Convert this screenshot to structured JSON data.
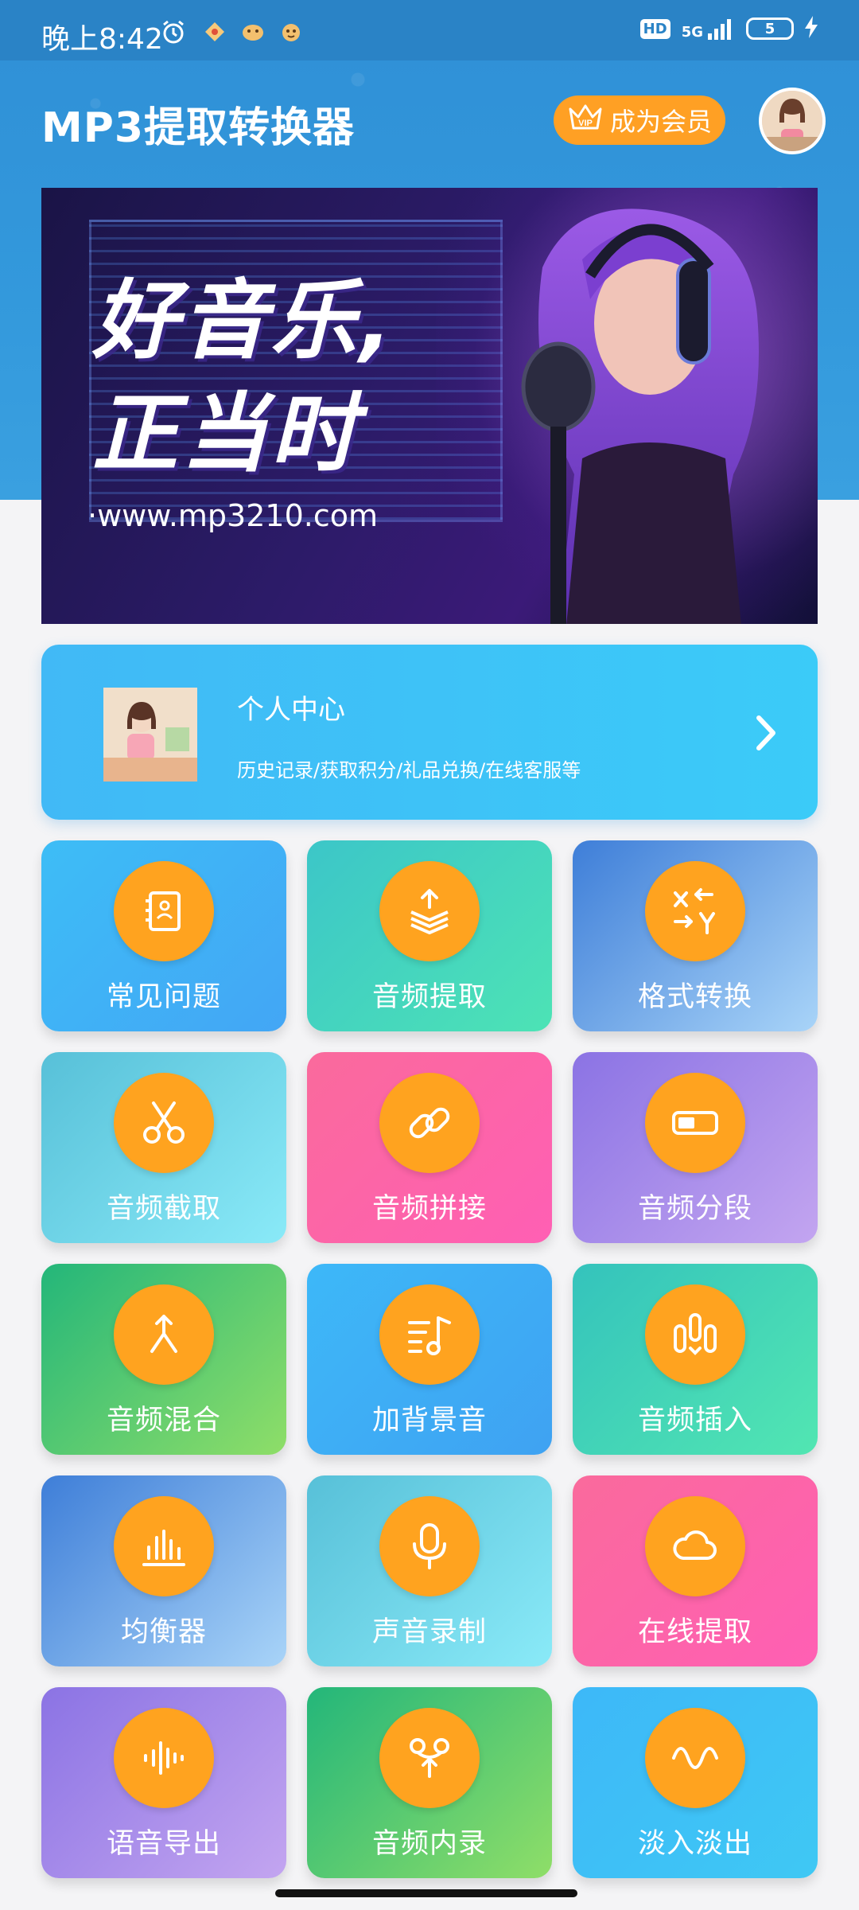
{
  "status_bar": {
    "time": "晚上8:42",
    "hd": "HD",
    "network": "5G",
    "battery": "5"
  },
  "header": {
    "title": "MP3提取转换器",
    "vip_label": "成为会员",
    "vip_badge": "VIP"
  },
  "banner": {
    "line1": "好音乐,",
    "line2": "正当时",
    "url": "·www.mp3210.com"
  },
  "profile": {
    "title": "个人中心",
    "subtitle": "历史记录/获取积分/礼品兑换/在线客服等"
  },
  "tiles": [
    {
      "label": "常见问题",
      "icon": "faq-book-icon"
    },
    {
      "label": "音频提取",
      "icon": "extract-layers-icon"
    },
    {
      "label": "格式转换",
      "icon": "format-convert-icon"
    },
    {
      "label": "音频截取",
      "icon": "scissors-icon"
    },
    {
      "label": "音频拼接",
      "icon": "link-chain-icon"
    },
    {
      "label": "音频分段",
      "icon": "segment-toggle-icon"
    },
    {
      "label": "音频混合",
      "icon": "merge-arrow-icon"
    },
    {
      "label": "加背景音",
      "icon": "music-note-icon"
    },
    {
      "label": "音频插入",
      "icon": "insert-bars-icon"
    },
    {
      "label": "均衡器",
      "icon": "equalizer-icon"
    },
    {
      "label": "声音录制",
      "icon": "microphone-icon"
    },
    {
      "label": "在线提取",
      "icon": "cloud-icon"
    },
    {
      "label": "语音导出",
      "icon": "waveform-icon"
    },
    {
      "label": "音频内录",
      "icon": "internal-record-icon"
    },
    {
      "label": "淡入淡出",
      "icon": "sine-wave-icon"
    }
  ],
  "colors": {
    "accent_orange": "#ffa31f",
    "header_blue": "#3399dc"
  }
}
